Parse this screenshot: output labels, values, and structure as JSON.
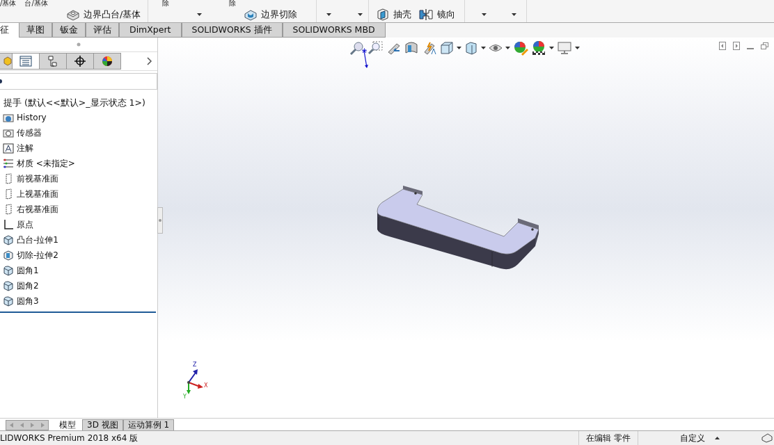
{
  "ribbon": {
    "groups": [
      {
        "top_labels": [
          "/基体",
          "台/基体"
        ],
        "items": [
          {
            "kind": "command",
            "label": "边界凸台/基体"
          }
        ]
      },
      {
        "top_labels": [
          "除",
          "除"
        ],
        "items": [
          {
            "kind": "dropdown"
          },
          {
            "kind": "command",
            "label": "边界切除"
          }
        ]
      },
      {
        "items": [
          {
            "kind": "dropdown"
          },
          {
            "kind": "dropdown"
          }
        ]
      },
      {
        "items": [
          {
            "kind": "command",
            "label": "抽壳"
          },
          {
            "kind": "command",
            "label": "镜向"
          }
        ]
      },
      {
        "items": [
          {
            "kind": "dropdown"
          },
          {
            "kind": "dropdown"
          }
        ]
      }
    ]
  },
  "command_tabs": [
    {
      "label": "征",
      "selected": true
    },
    {
      "label": "草图",
      "selected": false
    },
    {
      "label": "钣金",
      "selected": false
    },
    {
      "label": "评估",
      "selected": false
    },
    {
      "label": "DimXpert",
      "selected": false
    },
    {
      "label": "SOLIDWORKS 插件",
      "selected": false
    },
    {
      "label": "SOLIDWORKS MBD",
      "selected": false
    }
  ],
  "manager_tabs": [
    {
      "kind": "feature",
      "selected": false
    },
    {
      "kind": "property",
      "selected": true
    },
    {
      "kind": "config",
      "selected": false
    },
    {
      "kind": "dim",
      "selected": false
    },
    {
      "kind": "display",
      "selected": false
    }
  ],
  "tree": {
    "root": "提手  (默认<<默认>_显示状态 1>)",
    "items": [
      {
        "kind": "history",
        "label": "History"
      },
      {
        "kind": "sensor",
        "label": "传感器"
      },
      {
        "kind": "annotation",
        "label": "注解"
      },
      {
        "kind": "material",
        "label": "材质 <未指定>"
      },
      {
        "kind": "plane",
        "label": "前视基准面"
      },
      {
        "kind": "plane",
        "label": "上视基准面"
      },
      {
        "kind": "plane",
        "label": "右视基准面"
      },
      {
        "kind": "origin",
        "label": "原点"
      },
      {
        "kind": "extrude",
        "label": "凸台-拉伸1"
      },
      {
        "kind": "cut",
        "label": "切除-拉伸2"
      },
      {
        "kind": "fillet",
        "label": "圆角1"
      },
      {
        "kind": "fillet",
        "label": "圆角2"
      },
      {
        "kind": "fillet",
        "label": "圆角3"
      }
    ]
  },
  "triad": {
    "x": "X",
    "y": "Y",
    "z": "Z"
  },
  "model_tabs": [
    {
      "label": "模型",
      "selected": true
    },
    {
      "label": "3D 视图",
      "selected": false
    },
    {
      "label": "运动算例 1",
      "selected": false
    }
  ],
  "status_bar": {
    "product": "LIDWORKS Premium 2018 x64 版",
    "mode": "在编辑 零件",
    "units": "自定义"
  }
}
